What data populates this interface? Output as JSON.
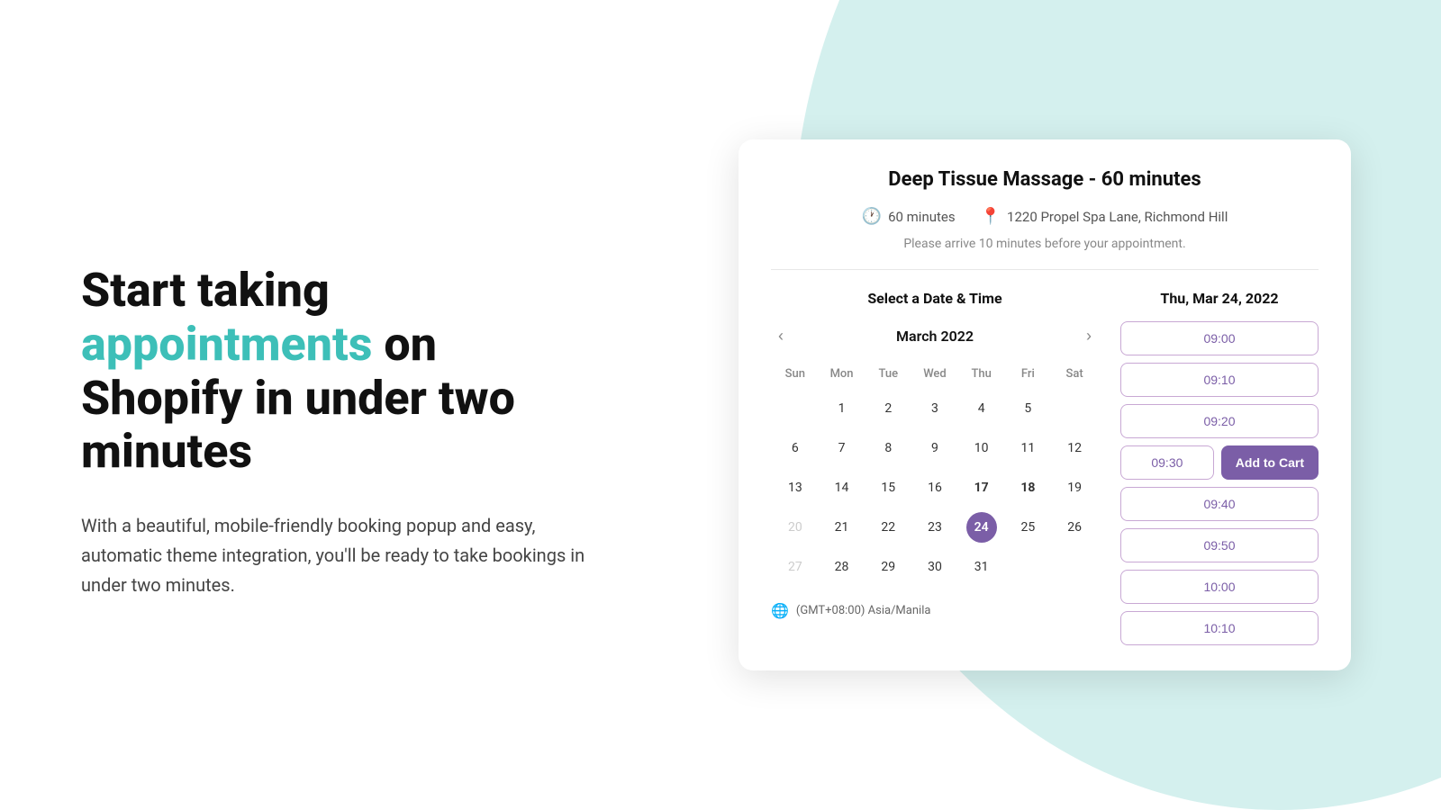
{
  "background": {
    "color": "#d4f0ee"
  },
  "left_panel": {
    "heading_plain": "Start taking ",
    "heading_accent": "appointments",
    "heading_rest": " on Shopify in under two minutes",
    "subtext": "With a beautiful, mobile-friendly booking popup and easy, automatic theme integration, you'll be ready to take bookings in under two minutes.",
    "accent_color": "#3dbfb8"
  },
  "widget": {
    "title": "Deep Tissue Massage - 60 minutes",
    "duration": "60 minutes",
    "location": "1220 Propel Spa Lane, Richmond Hill",
    "note": "Please arrive 10 minutes before your appointment.",
    "select_section_title": "Select a Date & Time",
    "selected_date_label": "Thu, Mar 24, 2022",
    "calendar": {
      "month_label": "March 2022",
      "day_headers": [
        "Sun",
        "Mon",
        "Tue",
        "Wed",
        "Thu",
        "Fri",
        "Sat"
      ],
      "weeks": [
        [
          {
            "day": "",
            "type": "empty"
          },
          {
            "day": "1",
            "type": "normal"
          },
          {
            "day": "2",
            "type": "normal"
          },
          {
            "day": "3",
            "type": "normal"
          },
          {
            "day": "4",
            "type": "normal"
          },
          {
            "day": "5",
            "type": "normal"
          },
          {
            "day": "",
            "type": "empty"
          }
        ],
        [
          {
            "day": "6",
            "type": "normal"
          },
          {
            "day": "7",
            "type": "normal"
          },
          {
            "day": "8",
            "type": "normal"
          },
          {
            "day": "9",
            "type": "normal"
          },
          {
            "day": "10",
            "type": "normal"
          },
          {
            "day": "11",
            "type": "normal"
          },
          {
            "day": "12",
            "type": "normal"
          }
        ],
        [
          {
            "day": "13",
            "type": "normal"
          },
          {
            "day": "14",
            "type": "normal"
          },
          {
            "day": "15",
            "type": "normal"
          },
          {
            "day": "16",
            "type": "normal"
          },
          {
            "day": "17",
            "type": "bold"
          },
          {
            "day": "18",
            "type": "bold"
          },
          {
            "day": "19",
            "type": "normal"
          }
        ],
        [
          {
            "day": "20",
            "type": "other-month"
          },
          {
            "day": "21",
            "type": "normal"
          },
          {
            "day": "22",
            "type": "normal"
          },
          {
            "day": "23",
            "type": "normal"
          },
          {
            "day": "24",
            "type": "selected"
          },
          {
            "day": "25",
            "type": "normal"
          },
          {
            "day": "26",
            "type": "normal"
          }
        ],
        [
          {
            "day": "27",
            "type": "other-month"
          },
          {
            "day": "28",
            "type": "normal"
          },
          {
            "day": "29",
            "type": "normal"
          },
          {
            "day": "30",
            "type": "normal"
          },
          {
            "day": "31",
            "type": "normal"
          },
          {
            "day": "",
            "type": "empty"
          },
          {
            "day": "",
            "type": "empty"
          }
        ]
      ],
      "timezone": "(GMT+08:00) Asia/Manila"
    },
    "time_slots": [
      {
        "time": "09:00",
        "type": "normal"
      },
      {
        "time": "09:10",
        "type": "normal"
      },
      {
        "time": "09:20",
        "type": "normal"
      },
      {
        "time": "09:30",
        "type": "selected-row"
      },
      {
        "time": "09:40",
        "type": "normal"
      },
      {
        "time": "09:50",
        "type": "normal"
      },
      {
        "time": "10:00",
        "type": "normal"
      },
      {
        "time": "10:10",
        "type": "normal"
      }
    ],
    "add_to_cart_label": "Add to Cart",
    "selected_slot_time": "09:30"
  }
}
